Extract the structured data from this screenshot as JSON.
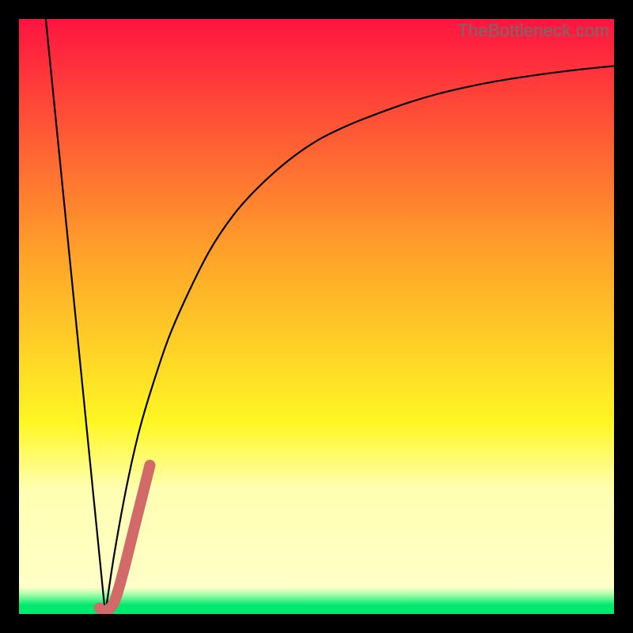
{
  "watermark": "TheBottleneck.com",
  "colors": {
    "black": "#000000",
    "curve": "#000000",
    "marker": "#d16a68",
    "red": "#ff1440",
    "orange": "#ffa429",
    "yellow": "#fff724",
    "pale_yellow": "#ffffb2",
    "green": "#00e96f"
  },
  "chart_data": {
    "type": "line",
    "title": "",
    "xlabel": "",
    "ylabel": "",
    "xlim": [
      0,
      100
    ],
    "ylim": [
      0,
      100
    ],
    "series": [
      {
        "name": "left-segment",
        "x": [
          4.5,
          14.5
        ],
        "y": [
          100,
          0
        ]
      },
      {
        "name": "right-curve",
        "x": [
          14.5,
          16,
          18,
          20,
          22,
          25,
          28,
          32,
          36,
          40,
          45,
          50,
          55,
          60,
          65,
          70,
          75,
          80,
          85,
          90,
          95,
          100
        ],
        "y": [
          0,
          10,
          21,
          30,
          37,
          46,
          53,
          61,
          67,
          71.5,
          76,
          79.5,
          82,
          84,
          85.8,
          87.3,
          88.5,
          89.5,
          90.3,
          91,
          91.6,
          92.1
        ]
      },
      {
        "name": "marker-j",
        "x": [
          13.5,
          14.5,
          16,
          17.5,
          19,
          20.5,
          22
        ],
        "y": [
          1,
          0.5,
          2,
          7,
          13,
          19,
          25
        ]
      }
    ],
    "gradient_stops": [
      {
        "offset": 0.0,
        "color": "#ff1440"
      },
      {
        "offset": 0.4,
        "color": "#ffa429"
      },
      {
        "offset": 0.68,
        "color": "#fff724"
      },
      {
        "offset": 0.79,
        "color": "#ffffb2"
      },
      {
        "offset": 0.955,
        "color": "#ffffc8"
      },
      {
        "offset": 0.965,
        "color": "#b7ffb0"
      },
      {
        "offset": 0.985,
        "color": "#00e96f"
      },
      {
        "offset": 1.0,
        "color": "#00e96f"
      }
    ]
  }
}
